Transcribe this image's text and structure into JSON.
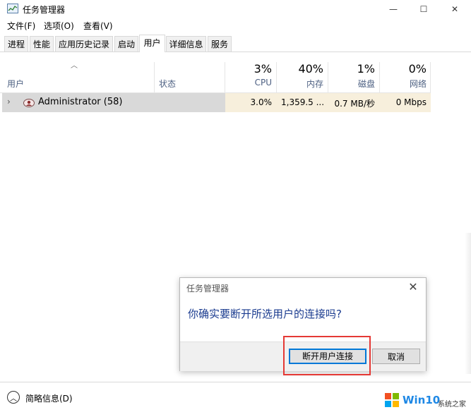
{
  "window": {
    "title": "任务管理器",
    "minimize": "—",
    "maximize": "☐",
    "close": "✕"
  },
  "menu": [
    "文件(F)",
    "选项(O)",
    "查看(V)"
  ],
  "tabs": [
    "进程",
    "性能",
    "应用历史记录",
    "启动",
    "用户",
    "详细信息",
    "服务"
  ],
  "active_tab": "用户",
  "columns": {
    "user": "用户",
    "status": "状态",
    "cpu": {
      "pct": "3%",
      "label": "CPU"
    },
    "memory": {
      "pct": "40%",
      "label": "内存"
    },
    "disk": {
      "pct": "1%",
      "label": "磁盘"
    },
    "network": {
      "pct": "0%",
      "label": "网络"
    }
  },
  "rows": [
    {
      "name": "Administrator (58)",
      "status": "",
      "cpu": "3.0%",
      "memory": "1,359.5 ...",
      "disk": "0.7 MB/秒",
      "network": "0 Mbps"
    }
  ],
  "dialog": {
    "title": "任务管理器",
    "message": "你确实要断开所选用户的连接吗?",
    "confirm_label": "断开用户连接",
    "cancel_label": "取消"
  },
  "footer": {
    "fewer_details": "简略信息(D)"
  },
  "watermark": {
    "brand": "Win10",
    "sub": "系统之家"
  },
  "colors": {
    "accent": "#0078d7",
    "highlight": "#e53935",
    "metric_bg": "#f7efdc"
  }
}
